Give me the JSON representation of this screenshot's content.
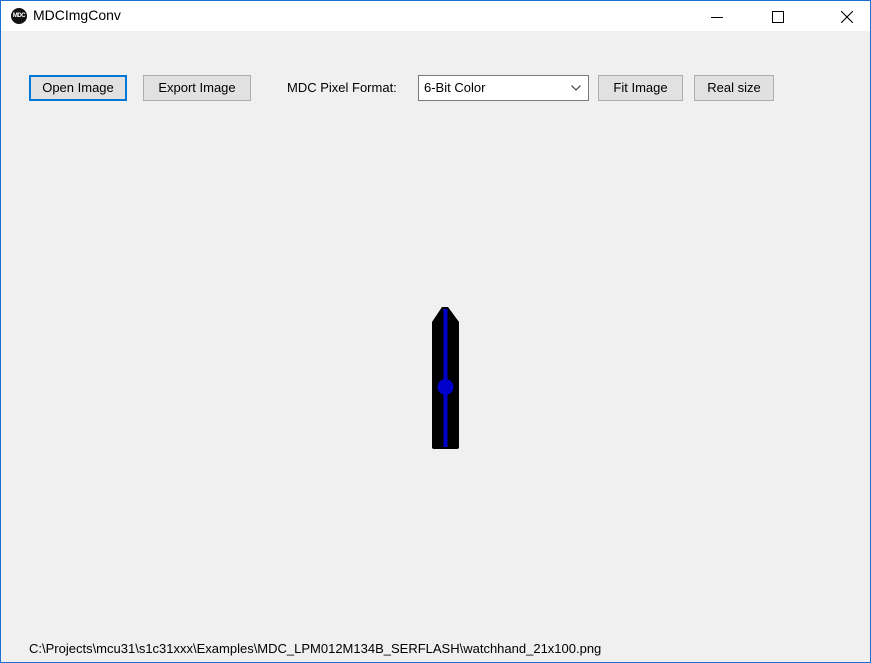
{
  "window": {
    "title": "MDCImgConv",
    "icon": "mdc-logo-icon",
    "icon_text": "MDC",
    "controls": [
      "minimize-icon",
      "maximize-icon",
      "close-icon"
    ]
  },
  "toolbar": {
    "open_label": "Open Image",
    "export_label": "Export Image",
    "format_label": "MDC Pixel Format:",
    "format_value": "6-Bit Color",
    "fit_label": "Fit Image",
    "real_size_label": "Real size"
  },
  "preview": {
    "image_name": "watchhand_21x100.png",
    "colors": {
      "body": "#000000",
      "stripe": "#0000cc"
    }
  },
  "status": {
    "file_path": "C:\\Projects\\mcu31\\s1c31xxx\\Examples\\MDC_LPM012M134B_SERFLASH\\watchhand_21x100.png"
  },
  "colors": {
    "focus": "#0078d7",
    "window_border": "#1e6fcf",
    "background": "#f0f0f0"
  }
}
